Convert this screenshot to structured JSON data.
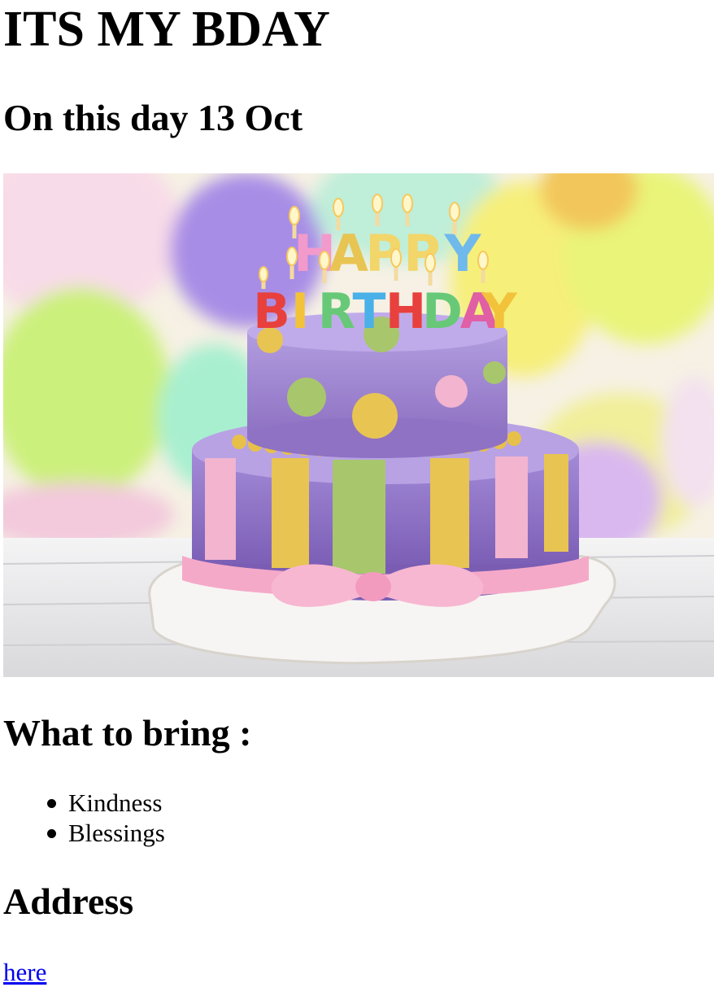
{
  "page": {
    "title": "ITS MY BDAY",
    "subtitle": "On this day 13 Oct"
  },
  "hero_image": {
    "name": "birthday-cake-image",
    "candle_text_top": "HAPPY",
    "candle_text_bottom": "BIRTHDAY",
    "colors": {
      "purple": "#9d7fd0",
      "yellow": "#e8c452",
      "green": "#a8c66c",
      "pink": "#f2b4cf",
      "table": "#e9e9ea"
    }
  },
  "bring": {
    "heading": "What to bring :",
    "items": [
      "Kindness",
      "Blessings"
    ]
  },
  "address": {
    "heading": "Address",
    "link_text": "here"
  }
}
